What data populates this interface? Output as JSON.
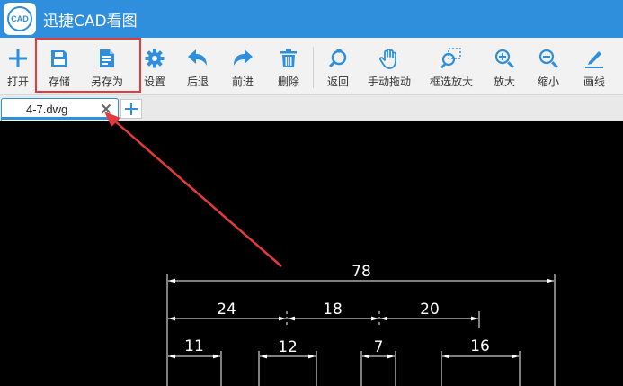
{
  "app": {
    "title": "迅捷CAD看图",
    "logo_text": "CAD"
  },
  "toolbar": {
    "open": "打开",
    "save": "存储",
    "save_as": "另存为",
    "settings": "设置",
    "undo": "后退",
    "redo": "前进",
    "delete": "删除",
    "back": "返回",
    "pan": "手动拖动",
    "zoom_window": "框选放大",
    "zoom_in": "放大",
    "zoom_out": "缩小",
    "draw_line": "画线"
  },
  "tabs": {
    "active_file": "4-7.dwg"
  },
  "drawing": {
    "dims": {
      "total": "78",
      "d24": "24",
      "d18": "18",
      "d20": "20",
      "d11": "11",
      "d12": "12",
      "d7": "7",
      "d16": "16"
    }
  },
  "colors": {
    "titlebar": "#2f8fdc",
    "accent_icon": "#2f8fdc",
    "highlight": "#e33b3b",
    "canvas": "#000000"
  }
}
